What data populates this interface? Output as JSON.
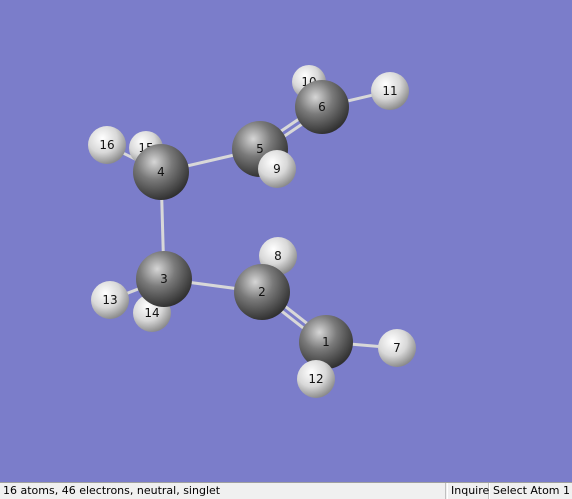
{
  "viewer": {
    "background": "#7b7dca",
    "carbon_color": "#6f6f6f",
    "hydrogen_color": "#e6e6e6",
    "bond_color": "#d8d8d8",
    "atoms": [
      {
        "label": "1",
        "element": "C"
      },
      {
        "label": "2",
        "element": "C"
      },
      {
        "label": "3",
        "element": "C"
      },
      {
        "label": "4",
        "element": "C"
      },
      {
        "label": "5",
        "element": "C"
      },
      {
        "label": "6",
        "element": "C"
      },
      {
        "label": "7",
        "element": "H"
      },
      {
        "label": "8",
        "element": "H"
      },
      {
        "label": "9",
        "element": "H"
      },
      {
        "label": "10",
        "element": "H"
      },
      {
        "label": "11",
        "element": "H"
      },
      {
        "label": "12",
        "element": "H"
      },
      {
        "label": "13",
        "element": "H"
      },
      {
        "label": "14",
        "element": "H"
      },
      {
        "label": "15",
        "element": "H"
      },
      {
        "label": "16",
        "element": "H"
      }
    ]
  },
  "statusbar": {
    "info": "16 atoms, 46 electrons, neutral, singlet",
    "mode": "Inquire",
    "action": "Select Atom 1"
  }
}
